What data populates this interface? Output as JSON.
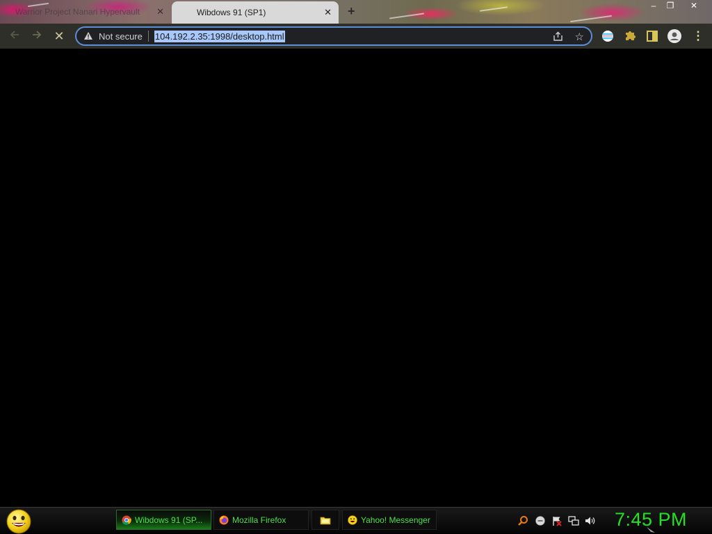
{
  "browser": {
    "tabs": [
      {
        "title": "Warrior Project Nanari Hypervault",
        "active": false
      },
      {
        "title": "Wibdows 91 (SP1)",
        "active": true
      }
    ],
    "close_glyph": "✕",
    "new_tab_glyph": "+",
    "window_controls": {
      "minimize": "–",
      "restore": "❐",
      "close": "✕"
    },
    "toolbar": {
      "back_icon": "arrow-left-icon",
      "forward_icon": "arrow-right-icon",
      "stop_glyph": "✕",
      "security_label": "Not secure",
      "url": "104.192.2.35:1998/desktop.html",
      "menu_glyph": "⋮"
    }
  },
  "taskbar": {
    "tasks": [
      {
        "label": "Wibdows 91 (SP...",
        "icon": "chrome-icon",
        "active": true
      },
      {
        "label": "Mozilla Firefox",
        "icon": "firefox-icon",
        "active": false
      },
      {
        "label": "",
        "icon": "folder-icon",
        "active": false
      },
      {
        "label": "Yahoo! Messenger",
        "icon": "yahoo-messenger-icon",
        "active": false
      }
    ],
    "tray_icons": [
      "search-icon",
      "messenger-status-icon",
      "flag-icon",
      "network-icon",
      "volume-icon"
    ],
    "clock": "7:45 PM"
  },
  "colors": {
    "taskbar_text": "#4fe04f",
    "clock": "#22e022",
    "url_highlight": "#a8c7fa",
    "omnibox_border": "#5b8ed6"
  }
}
